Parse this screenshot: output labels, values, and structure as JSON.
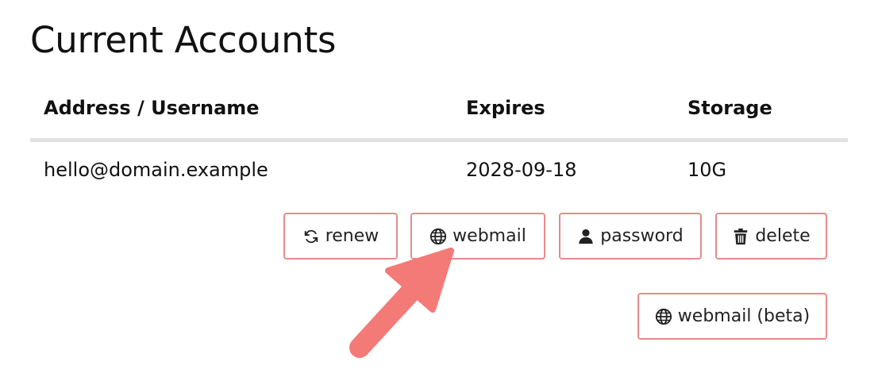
{
  "page": {
    "title": "Current Accounts"
  },
  "table": {
    "headers": {
      "address": "Address / Username",
      "expires": "Expires",
      "storage": "Storage"
    },
    "rows": [
      {
        "address": "hello@domain.example",
        "expires": "2028-09-18",
        "storage": "10G"
      }
    ]
  },
  "actions": {
    "renew": {
      "label": "renew",
      "icon": "refresh-icon"
    },
    "webmail": {
      "label": "webmail",
      "icon": "globe-icon"
    },
    "password": {
      "label": "password",
      "icon": "user-icon"
    },
    "delete": {
      "label": "delete",
      "icon": "trash-icon"
    },
    "webmail_beta": {
      "label": "webmail (beta)",
      "icon": "globe-icon"
    }
  },
  "annotation": {
    "arrow_color": "#f47a78",
    "button_border_color": "#e98a8a"
  }
}
